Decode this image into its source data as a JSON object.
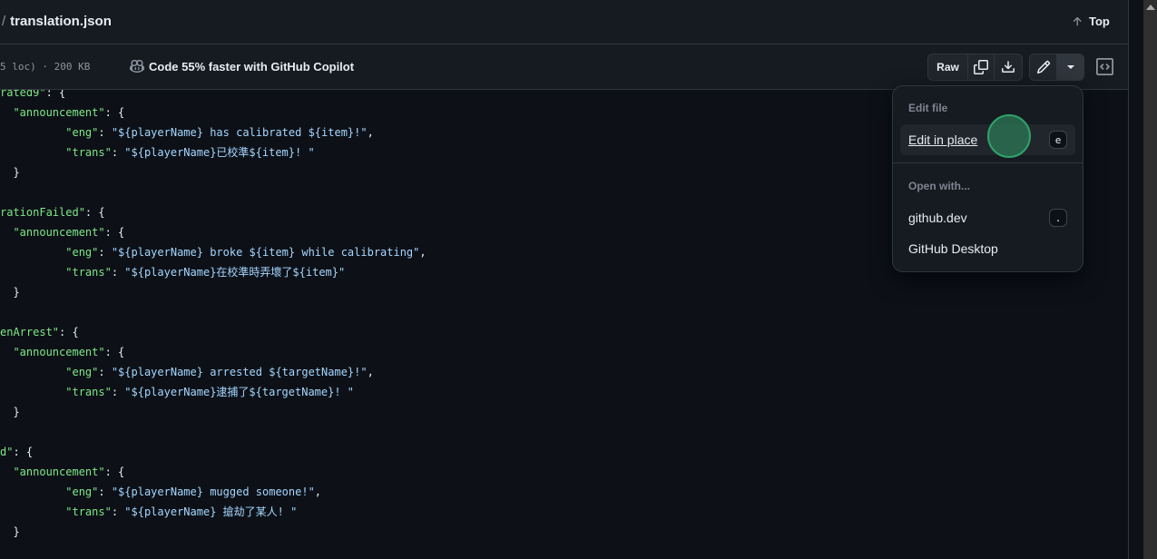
{
  "header": {
    "separator": "/",
    "file_name": "translation.json",
    "top_label": "Top"
  },
  "toolbar": {
    "file_info": "5 loc) · 200 KB",
    "copilot_label": "Code 55% faster with GitHub Copilot",
    "raw_label": "Raw",
    "icons": {
      "copy": "copy-icon",
      "download": "download-icon",
      "edit": "pencil-icon",
      "more": "triangle-down-icon",
      "symbols": "code-square-icon"
    }
  },
  "dropdown": {
    "edit_group_label": "Edit file",
    "edit_in_place": {
      "label": "Edit in place",
      "shortcut": "e"
    },
    "open_group_label": "Open with...",
    "github_dev": {
      "label": "github.dev",
      "shortcut": "."
    },
    "github_desktop": {
      "label": "GitHub Desktop"
    }
  },
  "code": {
    "lines": [
      {
        "indent": "",
        "key": "rated9\"",
        "rest": ": {"
      },
      {
        "indent": "  ",
        "key": "\"announcement\"",
        "rest": ": {"
      },
      {
        "indent": "          ",
        "key": "\"eng\"",
        "sep": ": ",
        "value": "\"${playerName} has calibrated ${item}!\"",
        "tail": ","
      },
      {
        "indent": "          ",
        "key": "\"trans\"",
        "sep": ": ",
        "value": "\"${playerName}已校準${item}! \"",
        "tail": ""
      },
      {
        "indent": "  ",
        "rest": "}"
      },
      {
        "indent": "",
        "rest": ""
      },
      {
        "indent": "",
        "key": "rationFailed\"",
        "rest": ": {"
      },
      {
        "indent": "  ",
        "key": "\"announcement\"",
        "rest": ": {"
      },
      {
        "indent": "          ",
        "key": "\"eng\"",
        "sep": ": ",
        "value": "\"${playerName} broke ${item} while calibrating\"",
        "tail": ","
      },
      {
        "indent": "          ",
        "key": "\"trans\"",
        "sep": ": ",
        "value": "\"${playerName}在校準時弄壞了${item}\"",
        "tail": ""
      },
      {
        "indent": "  ",
        "rest": "}"
      },
      {
        "indent": "",
        "rest": ""
      },
      {
        "indent": "",
        "key": "enArrest\"",
        "rest": ": {"
      },
      {
        "indent": "  ",
        "key": "\"announcement\"",
        "rest": ": {"
      },
      {
        "indent": "          ",
        "key": "\"eng\"",
        "sep": ": ",
        "value": "\"${playerName} arrested ${targetName}!\"",
        "tail": ","
      },
      {
        "indent": "          ",
        "key": "\"trans\"",
        "sep": ": ",
        "value": "\"${playerName}逮捕了${targetName}! \"",
        "tail": ""
      },
      {
        "indent": "  ",
        "rest": "}"
      },
      {
        "indent": "",
        "rest": ""
      },
      {
        "indent": "",
        "key": "d\"",
        "rest": ": {"
      },
      {
        "indent": "  ",
        "key": "\"announcement\"",
        "rest": ": {"
      },
      {
        "indent": "          ",
        "key": "\"eng\"",
        "sep": ": ",
        "value": "\"${playerName} mugged someone!\"",
        "tail": ","
      },
      {
        "indent": "          ",
        "key": "\"trans\"",
        "sep": ": ",
        "value": "\"${playerName} 搶劫了某人! \"",
        "tail": ""
      },
      {
        "indent": "  ",
        "rest": "}"
      },
      {
        "indent": "",
        "rest": ""
      }
    ]
  },
  "colors": {
    "json_key": "#7ee787",
    "json_string": "#a5d6ff",
    "background": "#0d1117",
    "panel": "#161b22",
    "border": "#30363d"
  }
}
